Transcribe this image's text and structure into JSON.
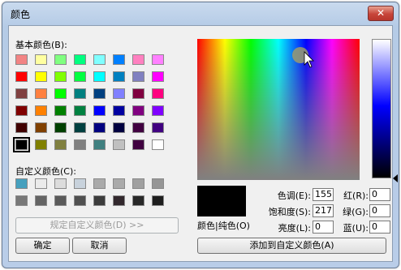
{
  "window": {
    "title": "颜色",
    "close_glyph": "✕"
  },
  "basic_colors": {
    "label": "基本颜色(B):",
    "rows": [
      [
        "#f28484",
        "#ffffa0",
        "#80ff80",
        "#00ff80",
        "#80ffff",
        "#0080ff",
        "#ff80c0",
        "#ff80ff"
      ],
      [
        "#ff0000",
        "#ffff00",
        "#80ff00",
        "#00ff40",
        "#00ffff",
        "#0080c0",
        "#8080c0",
        "#ff00ff"
      ],
      [
        "#804040",
        "#ff8040",
        "#00ff00",
        "#008080",
        "#004080",
        "#8080ff",
        "#800040",
        "#ff0080"
      ],
      [
        "#800000",
        "#ff8000",
        "#008000",
        "#008040",
        "#0000ff",
        "#0000a0",
        "#800080",
        "#8000ff"
      ],
      [
        "#400000",
        "#804000",
        "#004000",
        "#004040",
        "#000080",
        "#000040",
        "#400040",
        "#400080"
      ],
      [
        "#000000",
        "#808000",
        "#808040",
        "#808080",
        "#408080",
        "#c0c0c0",
        "#400040",
        "#ffffff"
      ]
    ],
    "selected_row": 5,
    "selected_col": 0
  },
  "custom_colors": {
    "label": "自定义颜色(C):",
    "rows": [
      [
        "#46a0be",
        "#ebebeb",
        "#dcdcdc",
        "#c8d2dc",
        "#aaaaaa",
        "#aaaaaa",
        "#a0a0a0",
        "#969696"
      ],
      [
        "#787878",
        "#646464",
        "#5a5a5a",
        "#505050",
        "#3c3c3c",
        "#32282d",
        "#282828",
        "#1e1e1e"
      ]
    ]
  },
  "buttons": {
    "define_custom": "规定自定义颜色(D) >>",
    "ok": "确定",
    "cancel": "取消",
    "add_custom": "添加到自定义颜色(A)"
  },
  "preview": {
    "label": "颜色|纯色(O)",
    "color": "#000000"
  },
  "fields": {
    "hue": {
      "label": "色调(E):",
      "value": "155"
    },
    "sat": {
      "label": "饱和度(S):",
      "value": "217"
    },
    "lum": {
      "label": "亮度(L):",
      "value": "0"
    },
    "red": {
      "label": "红(R):",
      "value": "0"
    },
    "green": {
      "label": "绿(G):",
      "value": "0"
    },
    "blue": {
      "label": "蓝(U):",
      "value": "0"
    }
  }
}
